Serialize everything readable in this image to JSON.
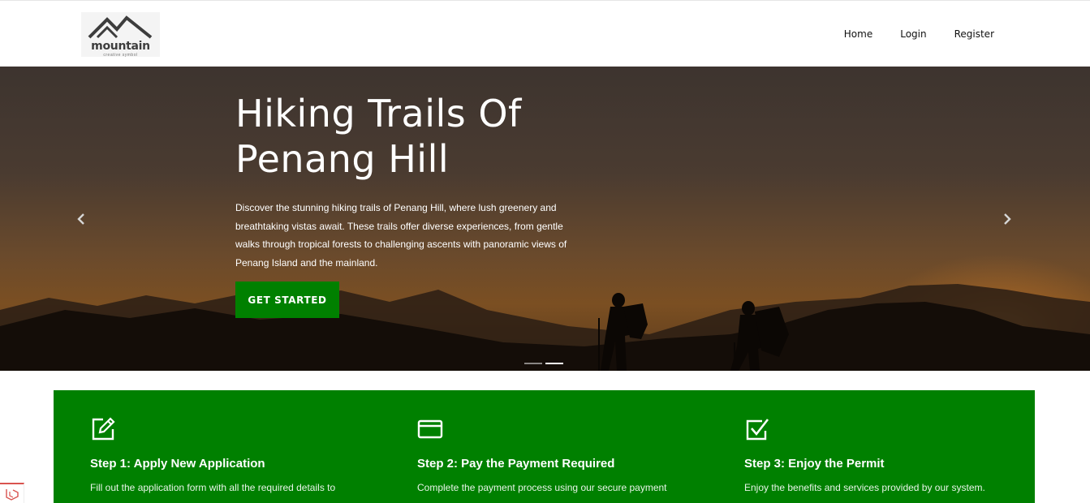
{
  "brand": {
    "logo_word": "mountain",
    "logo_tagline": "creative symbol"
  },
  "nav": {
    "items": [
      "Home",
      "Login",
      "Register"
    ]
  },
  "hero": {
    "title": "Hiking Trails Of Penang Hill",
    "description": "Discover the stunning hiking trails of Penang Hill, where lush greenery and breathtaking vistas await. These trails offer diverse experiences, from gentle walks through tropical forests to challenging ascents with panoramic views of Penang Island and the mainland.",
    "cta_label": "GET STARTED",
    "prev_icon": "chevron-left-icon",
    "next_icon": "chevron-right-icon",
    "slides_count": 2,
    "active_slide": 2
  },
  "steps": [
    {
      "icon": "edit-icon",
      "title": "Step 1: Apply New Application",
      "description": "Fill out the application form with all the required details to"
    },
    {
      "icon": "credit-card-icon",
      "title": "Step 2: Pay the Payment Required",
      "description": "Complete the payment process using our secure payment"
    },
    {
      "icon": "check-square-icon",
      "title": "Step 3: Enjoy the Permit",
      "description": "Enjoy the benefits and services provided by our system."
    }
  ],
  "colors": {
    "accent": "#008000",
    "hero_text": "#ffffff"
  }
}
